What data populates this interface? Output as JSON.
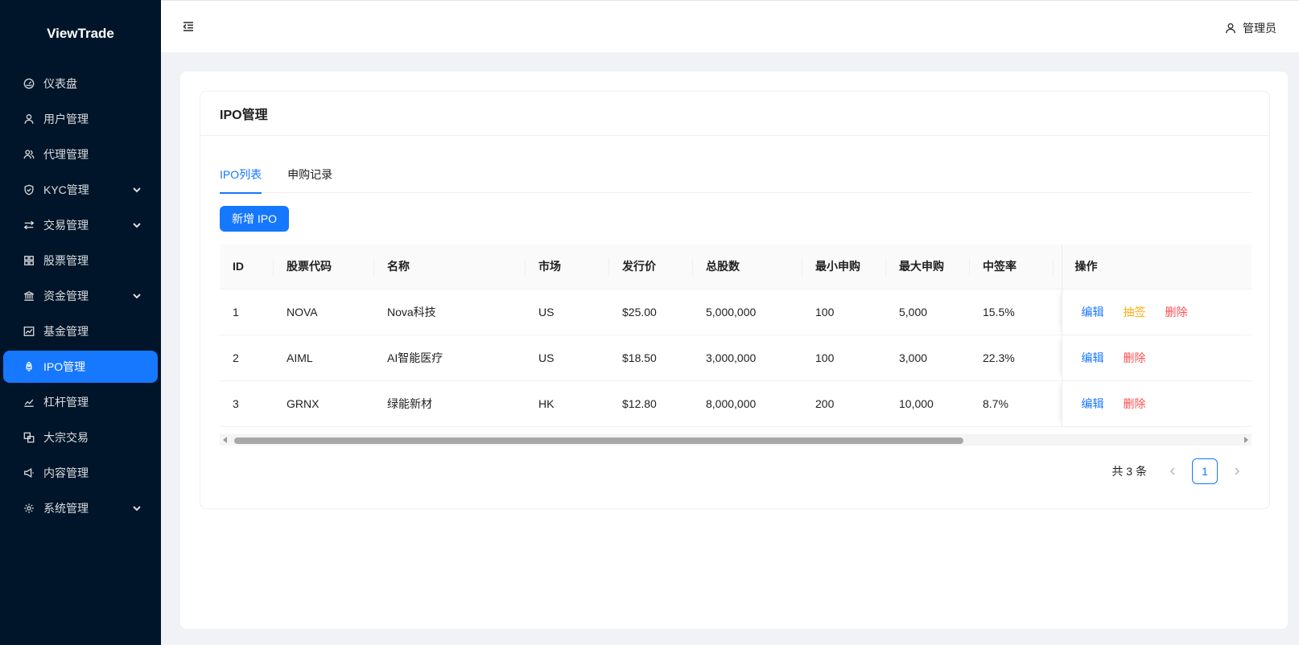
{
  "app": {
    "name": "ViewTrade"
  },
  "sidebar": {
    "items": [
      {
        "label": "仪表盘",
        "icon": "dashboard-icon",
        "expandable": false,
        "active": false
      },
      {
        "label": "用户管理",
        "icon": "user-icon",
        "expandable": false,
        "active": false
      },
      {
        "label": "代理管理",
        "icon": "team-icon",
        "expandable": false,
        "active": false
      },
      {
        "label": "KYC管理",
        "icon": "shield-icon",
        "expandable": true,
        "active": false
      },
      {
        "label": "交易管理",
        "icon": "swap-icon",
        "expandable": true,
        "active": false
      },
      {
        "label": "股票管理",
        "icon": "appstore-icon",
        "expandable": false,
        "active": false
      },
      {
        "label": "资金管理",
        "icon": "bank-icon",
        "expandable": true,
        "active": false
      },
      {
        "label": "基金管理",
        "icon": "fund-icon",
        "expandable": false,
        "active": false
      },
      {
        "label": "IPO管理",
        "icon": "rocket-icon",
        "expandable": false,
        "active": true
      },
      {
        "label": "杠杆管理",
        "icon": "line-chart-icon",
        "expandable": false,
        "active": false
      },
      {
        "label": "大宗交易",
        "icon": "block-icon",
        "expandable": false,
        "active": false
      },
      {
        "label": "内容管理",
        "icon": "notification-icon",
        "expandable": false,
        "active": false
      },
      {
        "label": "系统管理",
        "icon": "setting-icon",
        "expandable": true,
        "active": false
      }
    ]
  },
  "header": {
    "collapse_icon": "menu-fold-icon",
    "user_label": "管理员"
  },
  "page": {
    "title": "IPO管理",
    "tabs": [
      {
        "label": "IPO列表",
        "active": true
      },
      {
        "label": "申购记录",
        "active": false
      }
    ],
    "add_button_label": "新增 IPO"
  },
  "table": {
    "columns": [
      "ID",
      "股票代码",
      "名称",
      "市场",
      "发行价",
      "总股数",
      "最小申购",
      "最大申购",
      "中签率",
      "操作"
    ],
    "rows": [
      {
        "id": "1",
        "code": "NOVA",
        "name": "Nova科技",
        "market": "US",
        "price": "$25.00",
        "shares": "5,000,000",
        "min": "100",
        "max": "5,000",
        "rate": "15.5%",
        "actions": [
          "编辑",
          "抽签",
          "删除"
        ]
      },
      {
        "id": "2",
        "code": "AIML",
        "name": "AI智能医疗",
        "market": "US",
        "price": "$18.50",
        "shares": "3,000,000",
        "min": "100",
        "max": "3,000",
        "rate": "22.3%",
        "actions": [
          "编辑",
          "删除"
        ]
      },
      {
        "id": "3",
        "code": "GRNX",
        "name": "绿能新材",
        "market": "HK",
        "price": "$12.80",
        "shares": "8,000,000",
        "min": "200",
        "max": "10,000",
        "rate": "8.7%",
        "actions": [
          "编辑",
          "删除"
        ]
      }
    ]
  },
  "pagination": {
    "total_label": "共 3 条",
    "current_page": "1"
  },
  "colors": {
    "primary": "#1677ff",
    "sidebar_bg": "#001529",
    "warning": "#faad14",
    "danger": "#ff4d4f"
  }
}
